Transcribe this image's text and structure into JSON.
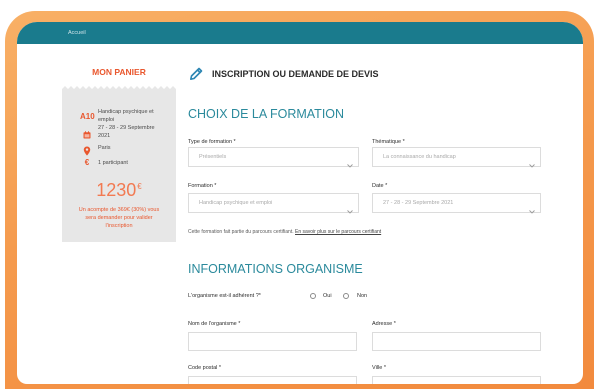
{
  "header": {
    "breadcrumb": "Accueil"
  },
  "cart": {
    "title": "MON PANIER",
    "course_code": "A10",
    "course_name_lines": [
      "Handicap psychique et",
      "emploi"
    ],
    "date_lines": [
      "27 - 28 - 29 Septembre",
      "2021"
    ],
    "location": "Paris",
    "price_icon": "€",
    "participants": "1 participant",
    "amount": "1230",
    "currency": "€",
    "deposit_note_lines": [
      "Un acompte de 369€ (30%) vous",
      "sera demander pour valider",
      "l'inscription"
    ]
  },
  "page": {
    "title": "INSCRIPTION OU DEMANDE DE DEVIS"
  },
  "section_formation": {
    "heading": "CHOIX DE LA FORMATION",
    "type_label": "Type de formation *",
    "type_value": "Présentiels",
    "theme_label": "Thématique *",
    "theme_value": "La connaissance du handicap",
    "formation_label": "Formation *",
    "formation_value": "Handicap psychique et emploi",
    "date_label": "Date *",
    "date_value": "27 - 28 - 29 Septembre 2021",
    "note": "Cette formation fait partie du parcours certifiant.",
    "note_link": "En savoir plus sur le parcours certifiant"
  },
  "section_organisme": {
    "heading": "INFORMATIONS ORGANISME",
    "member_question": "L'organisme est-il adhérent ?*",
    "option_yes": "Oui",
    "option_no": "Non",
    "name_label": "Nom de l'organisme *",
    "address_label": "Adresse *",
    "postal_label": "Code postal *",
    "city_label": "Ville *"
  },
  "icons": {
    "page_title": "pencil-icon",
    "cart_date": "calendar-icon",
    "cart_location": "map-pin-icon",
    "select_arrow": "chevron-down-icon"
  },
  "colors": {
    "accent": "#e9572e",
    "teal": "#2b8a9c",
    "header": "#1a7b8d",
    "price": "#f27a52",
    "frame_top": "#f8b066",
    "frame_bottom": "#f28a3d",
    "card": "#e7e7e7"
  }
}
